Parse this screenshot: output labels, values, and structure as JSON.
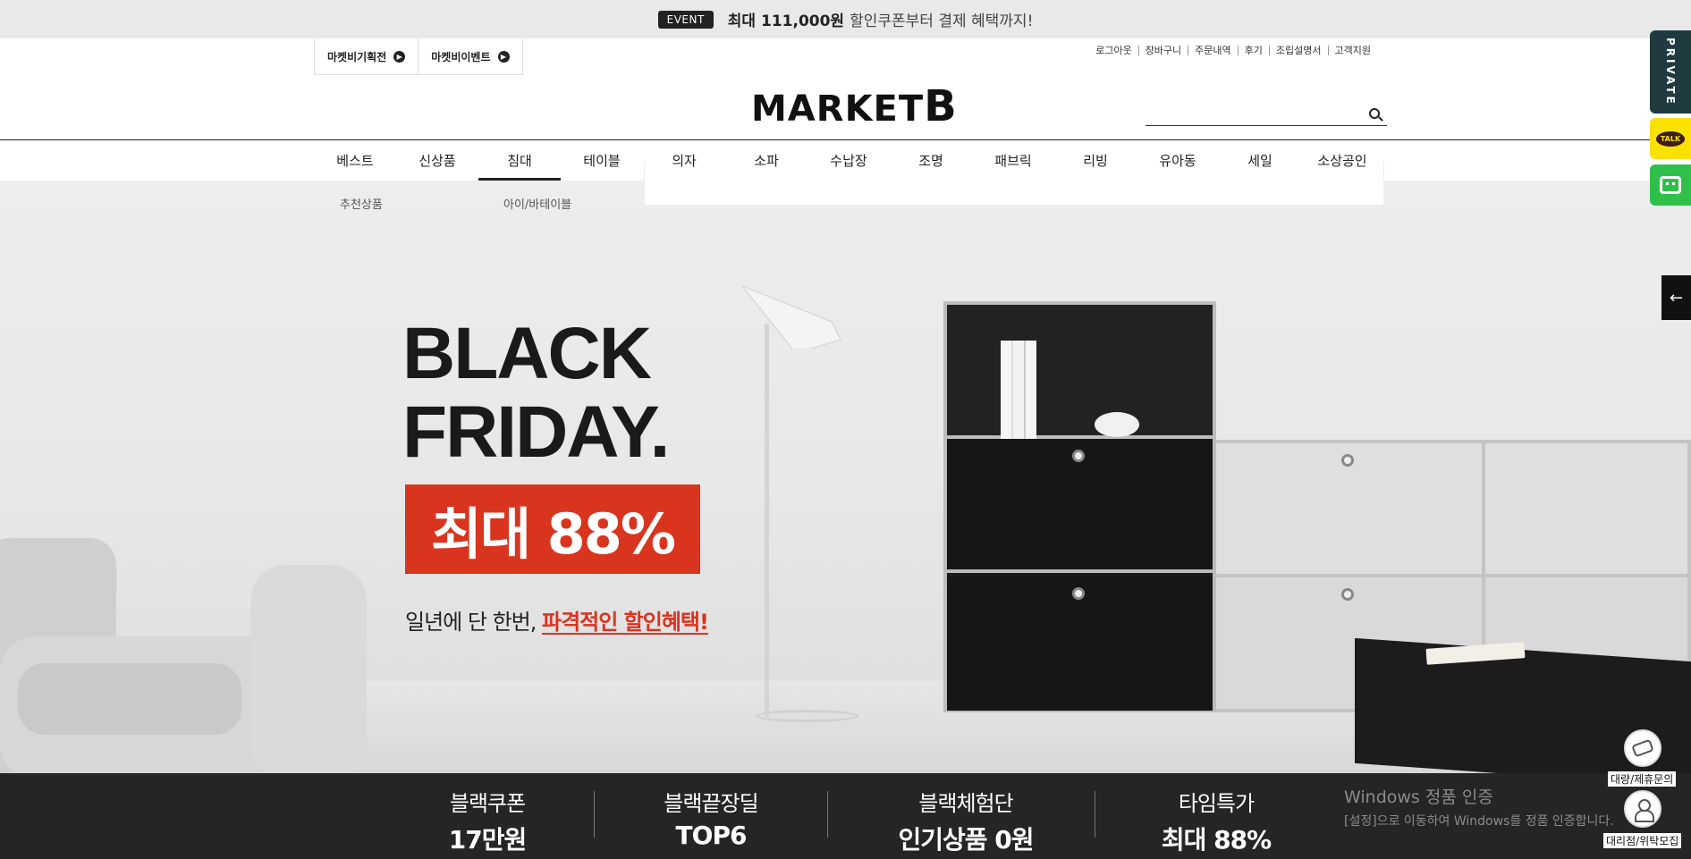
{
  "event_bar": {
    "badge": "EVENT",
    "strong": "최대 111,000원",
    "rest": "할인쿠폰부터 결제 혜택까지!"
  },
  "header": {
    "promo_tabs": [
      "마켓비기획전",
      "마켓비이벤트"
    ],
    "util_links": [
      "로그아웃",
      "장바구니",
      "주문내역",
      "후기",
      "조립설명서",
      "고객지원"
    ],
    "logo_main": "MARKET",
    "logo_b": "B",
    "search": {
      "placeholder": ""
    }
  },
  "nav": {
    "items": [
      "베스트",
      "신상품",
      "침대",
      "테이블",
      "의자",
      "소파",
      "수납장",
      "조명",
      "패브릭",
      "리빙",
      "유아동",
      "세일",
      "소상공인"
    ],
    "active": "침대",
    "sub_left": "추천상품",
    "sub_mid": "아이/바테이블"
  },
  "hero": {
    "headline_1": "BLACK",
    "headline_2": "FRIDAY.",
    "discount": "최대 88%",
    "subline_plain": "일년에 단 한번, ",
    "subline_red": "파격적인 할인혜택!"
  },
  "benefits": [
    {
      "title": "블랙쿠폰",
      "value": "17만원"
    },
    {
      "title": "블랙끝장딜",
      "value": "TOP6"
    },
    {
      "title": "블랙체험단",
      "value": "인기상품 0원"
    },
    {
      "title": "타임특가",
      "value": "최대 88%"
    }
  ],
  "windows_watermark": {
    "line1": "Windows 정품 인증",
    "line2": "[설정]으로 이동하여 Windows를 정품 인증합니다."
  },
  "sidebar": {
    "private": "PRIVATE",
    "talk": "TALK",
    "arrow": "←",
    "float_1": "대량/제휴문의",
    "float_2": "대리점/위탁모집"
  }
}
